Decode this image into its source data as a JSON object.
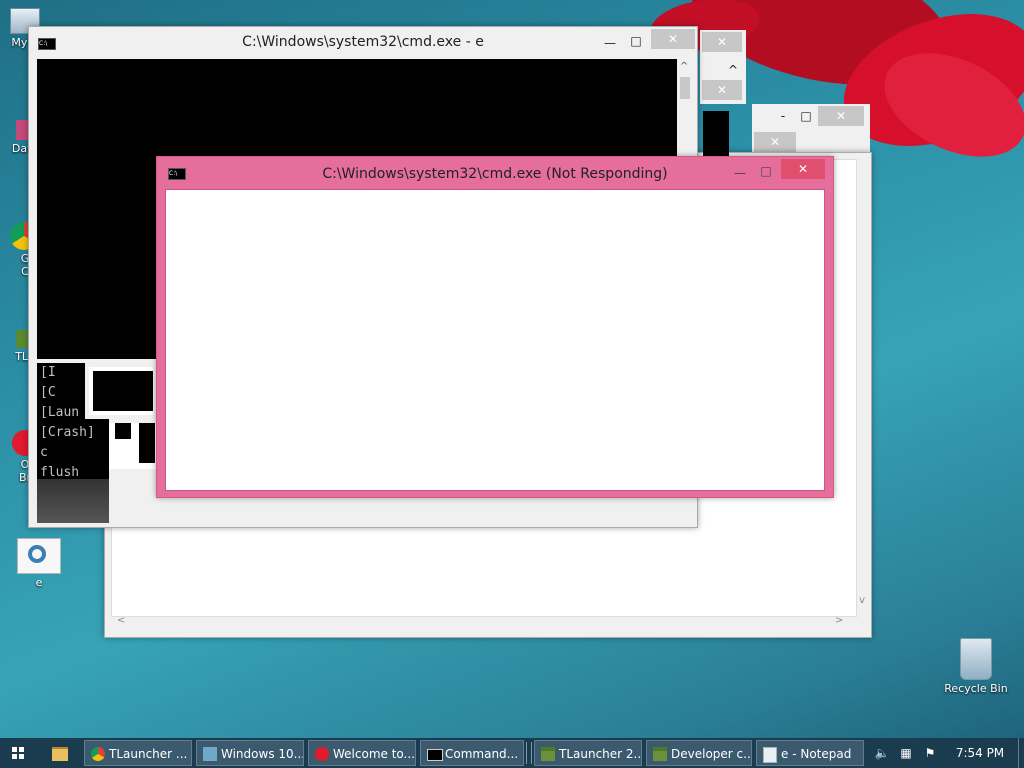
{
  "desktop": {
    "icons": [
      {
        "label": "My C",
        "icon": "computer-icon"
      },
      {
        "label": "Data",
        "icon": "data-shortcut-icon"
      },
      {
        "label": "G\nC",
        "icon": "chrome-shortcut-icon"
      },
      {
        "label": "TLa",
        "icon": "tlauncher-shortcut-icon"
      },
      {
        "label": "O\nBr",
        "icon": "opera-shortcut-icon"
      },
      {
        "label": "e",
        "icon": "settings-file-icon"
      },
      {
        "label": "Recycle Bin",
        "icon": "recycle-bin-icon"
      }
    ]
  },
  "windows": {
    "back_cmd": {
      "title": "C:\\Windows\\system32\\cmd.exe - e",
      "console_lines": [
        "[I",
        "[C",
        "[Laun",
        "[Crash] c",
        "flush now"
      ]
    },
    "front_cmd": {
      "title": "C:\\Windows\\system32\\cmd.exe (Not Responding)"
    },
    "close_glyph": "✕",
    "minimize_glyph": "—",
    "maximize_glyph": "□"
  },
  "taskbar": {
    "start_icon": "windows-logo-icon",
    "items": [
      {
        "label": "TLauncher ...",
        "icon": "chrome-icon"
      },
      {
        "label": "Windows 10...",
        "icon": "windows-store-icon"
      },
      {
        "label": "Welcome to...",
        "icon": "opera-icon"
      },
      {
        "label": "Command...",
        "icon": "cmd-icon"
      },
      {
        "label": "TLauncher 2...",
        "icon": "minecraft-block-icon"
      },
      {
        "label": "Developer c...",
        "icon": "minecraft-block-icon"
      },
      {
        "label": "e - Notepad",
        "icon": "notepad-icon"
      }
    ],
    "clock": "7:54 PM"
  },
  "colors": {
    "not_responding_frame": "#e56e9c",
    "desktop_accent": "#2b8fa6",
    "flower": "#d6102a"
  }
}
